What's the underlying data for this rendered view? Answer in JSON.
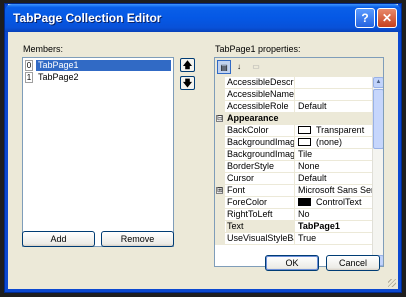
{
  "window": {
    "title": "TabPage Collection Editor",
    "help_glyph": "?",
    "close_glyph": "✕"
  },
  "members": {
    "label": "Members:",
    "items": [
      {
        "index": "0",
        "name": "TabPage1",
        "selected": true
      },
      {
        "index": "1",
        "name": "TabPage2",
        "selected": false
      }
    ],
    "move_up_glyph": "🡅",
    "move_down_glyph": "🡇"
  },
  "buttons": {
    "add": "Add",
    "remove": "Remove",
    "ok": "OK",
    "cancel": "Cancel"
  },
  "properties": {
    "label": "TabPage1 properties:",
    "toolbar": {
      "categorized_icon": "categorized-icon",
      "alphabetical_icon": "alphabetical-icon",
      "pages_icon": "property-pages-icon"
    },
    "rows": [
      {
        "name": "AccessibleDescrip",
        "value": ""
      },
      {
        "name": "AccessibleName",
        "value": ""
      },
      {
        "name": "AccessibleRole",
        "value": "Default"
      },
      {
        "name": "Appearance",
        "category": true,
        "expander": "⊟"
      },
      {
        "name": "BackColor",
        "value": "Transparent",
        "swatch": "#ffffff"
      },
      {
        "name": "BackgroundImage",
        "value": "(none)",
        "swatch": "#ffffff"
      },
      {
        "name": "BackgroundImage",
        "value": "Tile"
      },
      {
        "name": "BorderStyle",
        "value": "None"
      },
      {
        "name": "Cursor",
        "value": "Default"
      },
      {
        "name": "Font",
        "value": "Microsoft Sans Serif;",
        "expander": "⊞"
      },
      {
        "name": "ForeColor",
        "value": "ControlText",
        "swatch": "#000000"
      },
      {
        "name": "RightToLeft",
        "value": "No"
      },
      {
        "name": "Text",
        "value": "TabPage1",
        "highlight": true
      },
      {
        "name": "UseVisualStyleBac",
        "value": "True"
      }
    ]
  },
  "colors": {
    "titlebar": "#0558e5",
    "selection": "#316ac5",
    "face": "#ece9d8"
  }
}
